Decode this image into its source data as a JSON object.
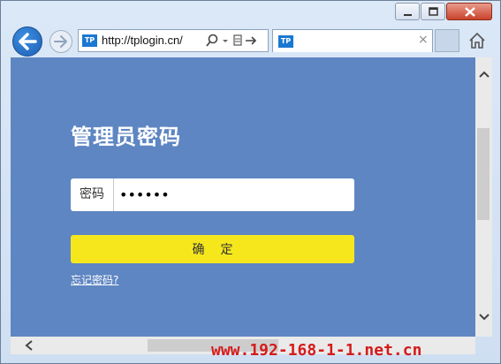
{
  "browser": {
    "address_url": "http://tplogin.cn/",
    "favicon_text": "TP",
    "tab_close": "×",
    "brand_color": "#1a77d2"
  },
  "page": {
    "title": "管理员密码",
    "password_label": "密码",
    "password_value": "••••••",
    "confirm_label": "确定",
    "forgot_link": "忘记密码?",
    "background_color": "#5e86c2",
    "button_color": "#f6e71d"
  },
  "scroll": {
    "up": "⌃",
    "down": "⌄",
    "left": "<",
    "right": ">"
  },
  "watermark": "www.192-168-1-1.net.cn"
}
